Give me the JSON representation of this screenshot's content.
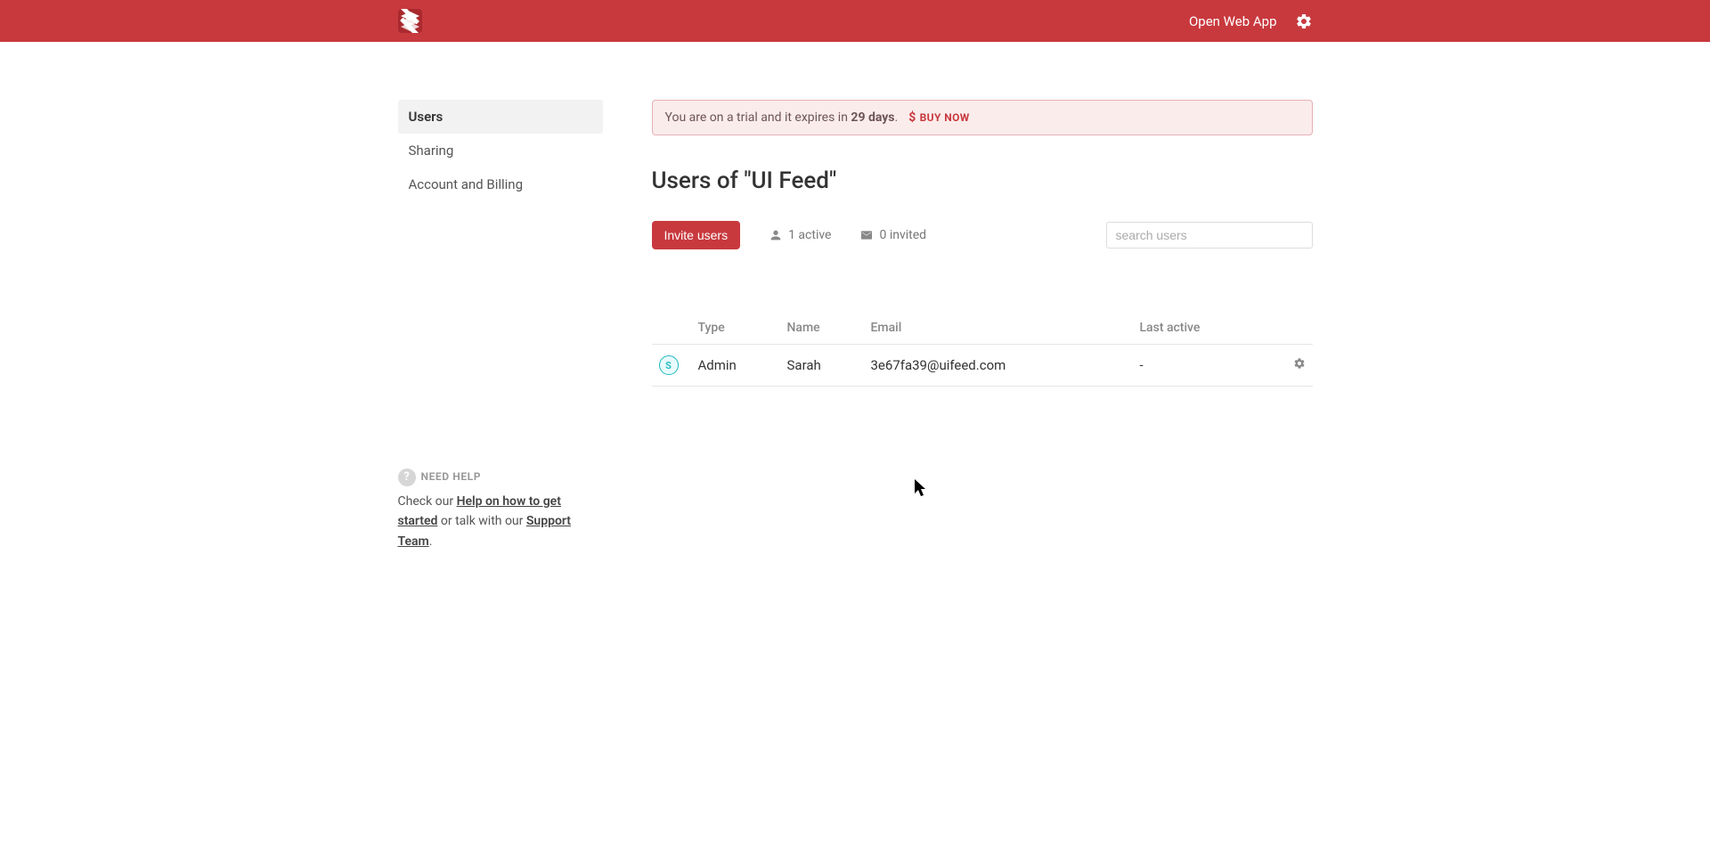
{
  "header": {
    "open_web_app": "Open Web App"
  },
  "sidebar": {
    "items": [
      {
        "label": "Users",
        "active": true
      },
      {
        "label": "Sharing",
        "active": false
      },
      {
        "label": "Account and Billing",
        "active": false
      }
    ]
  },
  "help": {
    "heading": "Need Help",
    "check_our": "Check our ",
    "help_link": "Help on how to get started",
    "mid": " or talk with our ",
    "support_link": "Support Team",
    "period": "."
  },
  "banner": {
    "pre": "You are on a trial and it expires in ",
    "days": "29 days",
    "post": ".",
    "buy_now": "Buy now"
  },
  "title": "Users of \"UI Feed\"",
  "toolbar": {
    "invite_label": "Invite users",
    "active_label": "1 active",
    "invited_label": "0 invited",
    "search_placeholder": "search users"
  },
  "table": {
    "columns": {
      "type": "Type",
      "name": "Name",
      "email": "Email",
      "last_active": "Last active"
    },
    "rows": [
      {
        "avatar_letter": "S",
        "type": "Admin",
        "name": "Sarah",
        "email": "3e67fa39@uifeed.com",
        "last_active": "-"
      }
    ]
  }
}
